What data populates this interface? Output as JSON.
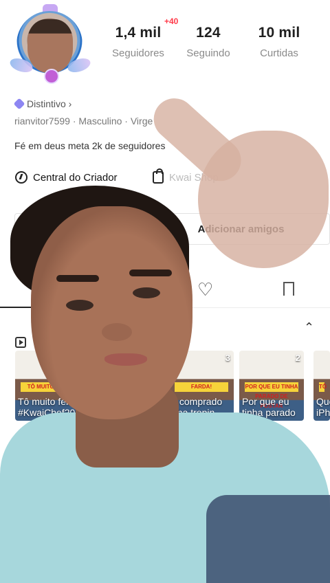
{
  "profile": {
    "stats": [
      {
        "value": "1,4 mil",
        "label": "Seguidores",
        "badge": "+40"
      },
      {
        "value": "124",
        "label": "Seguindo"
      },
      {
        "value": "10 mil",
        "label": "Curtidas"
      }
    ],
    "distintivo": "Distintivo ›",
    "meta": "rianvitor7599 · Masculino · Virge",
    "bio": "Fé em deus meta 2k de seguidores"
  },
  "quick_actions": {
    "creator": "Central do Criador",
    "shop": "Kwai Shop"
  },
  "buttons": {
    "add_friends": "Adicionar amigos"
  },
  "collection": {
    "thumbs": [
      {
        "caption": "Tô muito feli\n#KwaiChef20",
        "banner": "TÔ MUITO FELI"
      },
      {
        "caption": "s comprado\nnha tropin...",
        "count": "3",
        "banner": "FARDA!"
      },
      {
        "caption": "Por que eu\ntinha parado",
        "count": "2",
        "banner": "POR QUE EU TINHA PARADO DE POSTAR"
      },
      {
        "caption": "Que\niPh",
        "banner": "TÔ"
      }
    ]
  },
  "colors": {
    "accent_red": "#ff3b4a",
    "badge_purple": "#8d86f2",
    "shirt": "#a7d7dc"
  }
}
